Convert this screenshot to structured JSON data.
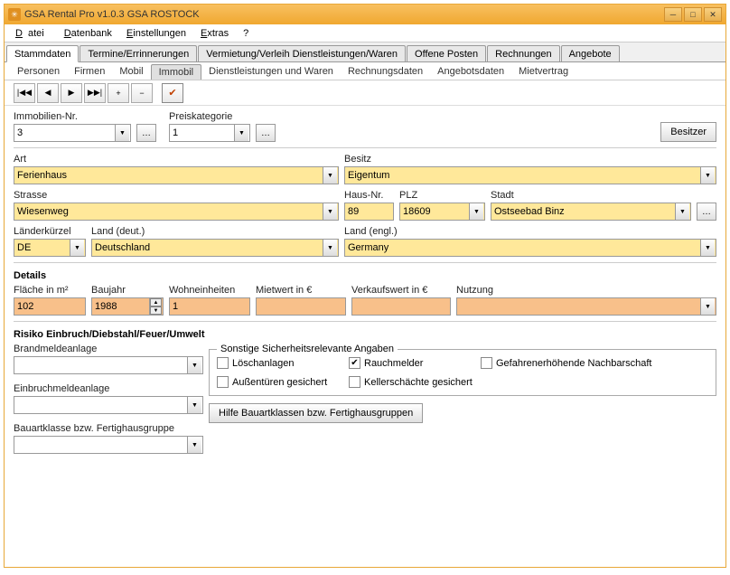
{
  "window": {
    "title": "GSA Rental Pro v1.0.3  GSA ROSTOCK"
  },
  "menu": {
    "datei": "Datei",
    "datenbank": "Datenbank",
    "einstellungen": "Einstellungen",
    "extras": "Extras",
    "help": "?"
  },
  "tabs1": {
    "stammdaten": "Stammdaten",
    "termine": "Termine/Errinnerungen",
    "vermietung": "Vermietung/Verleih Dienstleistungen/Waren",
    "offene": "Offene Posten",
    "rechnungen": "Rechnungen",
    "angebote": "Angebote"
  },
  "tabs2": {
    "personen": "Personen",
    "firmen": "Firmen",
    "mobil": "Mobil",
    "immobil": "Immobil",
    "dienst": "Dienstleistungen und Waren",
    "rechnungsdaten": "Rechnungsdaten",
    "angebotsdaten": "Angebotsdaten",
    "mietvertrag": "Mietvertrag"
  },
  "toolbar": {
    "first": "|◀◀",
    "prev": "◀",
    "next": "▶",
    "last": "▶▶|",
    "plus": "+",
    "minus": "−",
    "check": "✔"
  },
  "top": {
    "immobilien_label": "Immobilien-Nr.",
    "immobilien_value": "3",
    "preis_label": "Preiskategorie",
    "preis_value": "1",
    "besitzer": "Besitzer"
  },
  "general": {
    "art_label": "Art",
    "art_value": "Ferienhaus",
    "besitz_label": "Besitz",
    "besitz_value": "Eigentum",
    "strasse_label": "Strasse",
    "strasse_value": "Wiesenweg",
    "hausnr_label": "Haus-Nr.",
    "hausnr_value": "89",
    "plz_label": "PLZ",
    "plz_value": "18609",
    "stadt_label": "Stadt",
    "stadt_value": "Ostseebad Binz",
    "lk_label": "Länderkürzel",
    "lk_value": "DE",
    "land_de_label": "Land (deut.)",
    "land_de_value": "Deutschland",
    "land_en_label": "Land (engl.)",
    "land_en_value": "Germany"
  },
  "details": {
    "header": "Details",
    "flaeche_label": "Fläche in m²",
    "flaeche_value": "102",
    "baujahr_label": "Baujahr",
    "baujahr_value": "1988",
    "wohn_label": "Wohneinheiten",
    "wohn_value": "1",
    "miet_label": "Mietwert in €",
    "miet_value": "",
    "verkauf_label": "Verkaufswert in €",
    "verkauf_value": "",
    "nutzung_label": "Nutzung",
    "nutzung_value": ""
  },
  "risiko": {
    "header": "Risiko Einbruch/Diebstahl/Feuer/Umwelt",
    "brand_label": "Brandmeldeanlage",
    "einbruch_label": "Einbruchmeldeanlage",
    "bauart_label": "Bauartklasse bzw. Fertighausgruppe",
    "group_legend": "Sonstige Sicherheitsrelevante Angaben",
    "loesch": "Löschanlagen",
    "rauch": "Rauchmelder",
    "gefahr": "Gefahrenerhöhende Nachbarschaft",
    "aussen": "Außentüren gesichert",
    "keller": "Kellerschächte gesichert",
    "hilfe_btn": "Hilfe Bauartklassen bzw. Fertighausgruppen"
  }
}
